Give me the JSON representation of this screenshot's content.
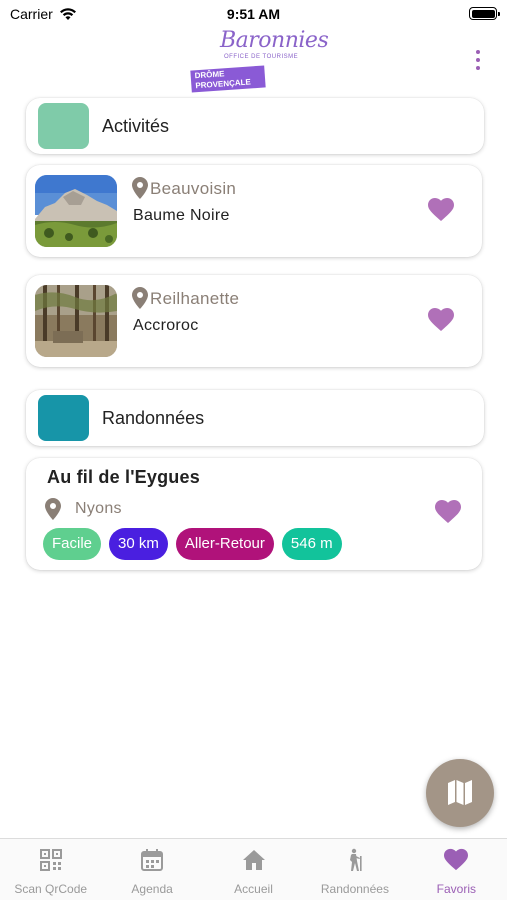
{
  "status_bar": {
    "carrier": "Carrier",
    "time": "9:51 AM"
  },
  "header": {
    "logo_title": "Baronnies",
    "logo_subtitle": "OFFICE DE TOURISME",
    "logo_band_line1": "DRÔME",
    "logo_band_line2": "PROVENÇALE"
  },
  "sections": {
    "activites": {
      "title": "Activités",
      "color": "#7fcba9"
    },
    "randonnees": {
      "title": "Randonnées",
      "color": "#1795a8"
    }
  },
  "activities": [
    {
      "location": "Beauvoisin",
      "title": "Baume Noire",
      "favorite": true
    },
    {
      "location": "Reilhanette",
      "title": "Accroroc",
      "favorite": true
    }
  ],
  "hike": {
    "title": "Au fil de l'Eygues",
    "location": "Nyons",
    "favorite": true,
    "tags": [
      {
        "label": "Facile",
        "color": "#5fcf8f"
      },
      {
        "label": "30 km",
        "color": "#4a1fe0"
      },
      {
        "label": "Aller-Retour",
        "color": "#b0127a"
      },
      {
        "label": "546 m",
        "color": "#12c39b"
      }
    ]
  },
  "fab": {
    "icon": "map-icon"
  },
  "tab_bar": {
    "tabs": [
      {
        "label": "Scan QrCode",
        "icon": "qr-code-icon"
      },
      {
        "label": "Agenda",
        "icon": "calendar-icon"
      },
      {
        "label": "Accueil",
        "icon": "home-icon"
      },
      {
        "label": "Randonnées",
        "icon": "hiker-icon"
      },
      {
        "label": "Favoris",
        "icon": "heart-icon"
      }
    ],
    "active": "Favoris"
  },
  "colors": {
    "accent": "#9b5fb5",
    "heart": "#b070b8",
    "location_text": "#8a7f76",
    "fab": "#a39587"
  }
}
